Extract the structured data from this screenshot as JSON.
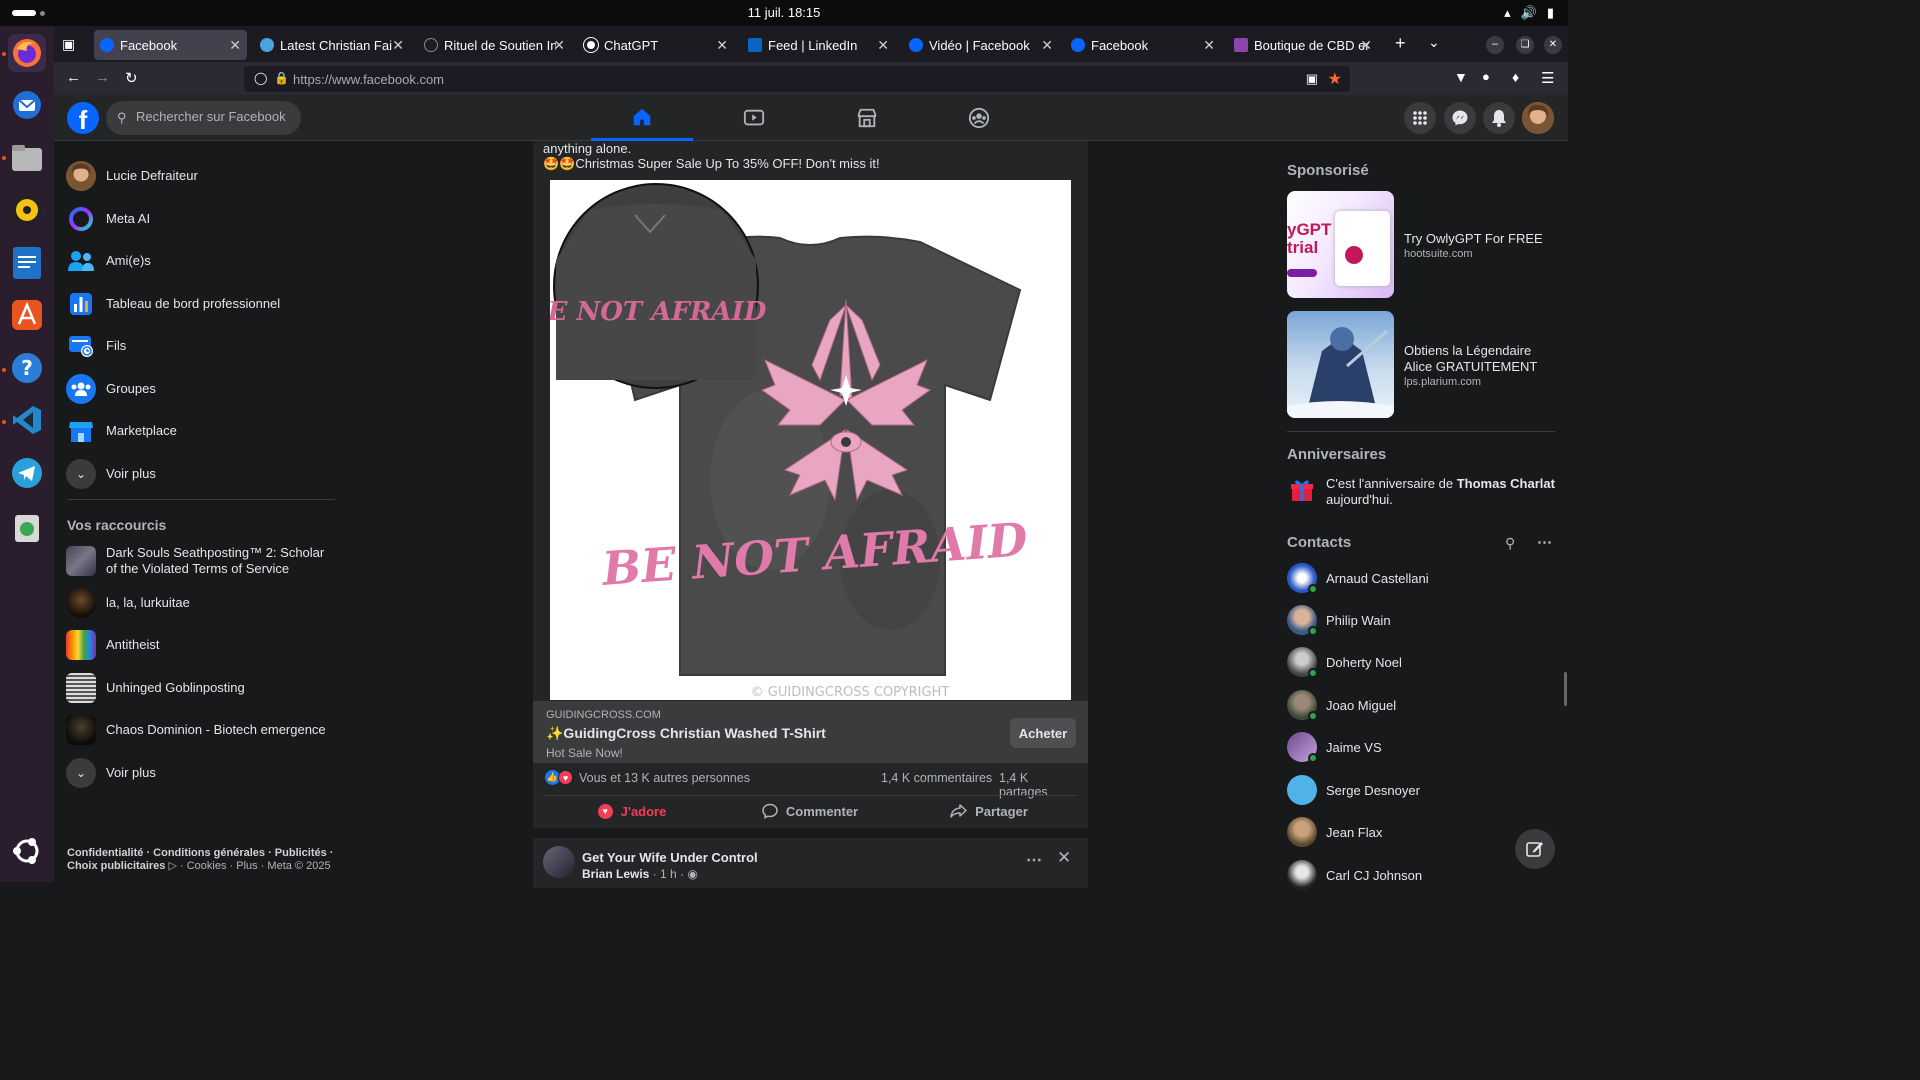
{
  "system": {
    "clock": "11 juil.  18:15"
  },
  "dock": {
    "icons": [
      "firefox-icon",
      "thunderbird-icon",
      "files-icon",
      "rhythmbox-icon",
      "writer-icon",
      "app-center-icon",
      "help-icon",
      "vscode-icon",
      "telegram-icon",
      "trash-icon",
      "ubuntu-apps-icon"
    ]
  },
  "browser": {
    "tabs": [
      {
        "label": "Facebook",
        "color": "#0866ff"
      },
      {
        "label": "Latest Christian Faith",
        "color": "#4aa3df"
      },
      {
        "label": "Rituel de Soutien Inti",
        "color": "#2b2a33"
      },
      {
        "label": "ChatGPT",
        "color": "#ffffff"
      },
      {
        "label": "Feed | LinkedIn",
        "color": "#0a66c2"
      },
      {
        "label": "Vidéo | Facebook",
        "color": "#0866ff"
      },
      {
        "label": "Facebook",
        "color": "#0866ff"
      },
      {
        "label": "Boutique de CBD en l",
        "color": "#8e44ad"
      }
    ],
    "url": "https://www.facebook.com"
  },
  "facebook": {
    "search_placeholder": "Rechercher sur Facebook",
    "left_nav": [
      {
        "label": "Lucie Defraiteur",
        "icon": "avatar"
      },
      {
        "label": "Meta AI",
        "icon": "meta-ai-icon"
      },
      {
        "label": "Ami(e)s",
        "icon": "friends-icon"
      },
      {
        "label": "Tableau de bord professionnel",
        "icon": "dashboard-icon"
      },
      {
        "label": "Fils",
        "icon": "feeds-icon"
      },
      {
        "label": "Groupes",
        "icon": "groups-icon"
      },
      {
        "label": "Marketplace",
        "icon": "marketplace-icon"
      },
      {
        "label": "Voir plus",
        "icon": "chevron-down-icon"
      }
    ],
    "shortcuts_title": "Vos raccourcis",
    "shortcuts": [
      {
        "label": "Dark Souls Seathposting™ 2: Scholar of the Violated Terms of Service"
      },
      {
        "label": "la, la, lurkuitae"
      },
      {
        "label": "Antitheist"
      },
      {
        "label": "Unhinged Goblinposting"
      },
      {
        "label": "Chaos Dominion - Biotech emergence"
      },
      {
        "label": "Voir plus"
      }
    ],
    "footer": {
      "line1": "Confidentialité · Conditions générales · Publicités ·",
      "line2_a": "Choix publicitaires",
      "line2_b": "· Cookies · Plus · Meta © 2025"
    },
    "post": {
      "text_top": "anything alone.",
      "text_sale": "🤩🤩Christmas Super Sale Up To 35% OFF! Don't miss it!",
      "image_text": "BE NOT AFRAID",
      "image_watermark": "© GUIDINGCROSS COPYRIGHT",
      "link_domain": "GUIDINGCROSS.COM",
      "link_title": "✨GuidingCross Christian Washed T-Shirt",
      "link_sub": "Hot Sale Now!",
      "buy_label": "Acheter",
      "reactions_text": "Vous et 13 K autres personnes",
      "comments": "1,4 K commentaires",
      "shares": "1,4 K partages",
      "love_label": "J'adore",
      "comment_label": "Commenter",
      "share_label": "Partager"
    },
    "post2": {
      "title": "Get Your Wife Under Control",
      "author": "Brian Lewis",
      "time": "· 1 h ·"
    },
    "sponsored_title": "Sponsorisé",
    "ads": [
      {
        "title": "Try OwlyGPT For FREE",
        "site": "hootsuite.com",
        "thumb_text": "yGPT trial"
      },
      {
        "title": "Obtiens la Légendaire Alice GRATUITEMENT",
        "site": "lps.plarium.com"
      }
    ],
    "birthdays_title": "Anniversaires",
    "birthday": {
      "pre": "C'est l'anniversaire de",
      "name": "Thomas Charlat",
      "post": "aujourd'hui."
    },
    "contacts_title": "Contacts",
    "contacts": [
      {
        "name": "Arnaud Castellani",
        "online": true
      },
      {
        "name": "Philip Wain",
        "online": true
      },
      {
        "name": "Doherty Noel",
        "online": true
      },
      {
        "name": "Joao Miguel",
        "online": true
      },
      {
        "name": "Jaime VS",
        "online": true
      },
      {
        "name": "Serge Desnoyer",
        "online": false
      },
      {
        "name": "Jean Flax",
        "online": false
      },
      {
        "name": "Carl CJ Johnson",
        "online": false
      }
    ]
  }
}
